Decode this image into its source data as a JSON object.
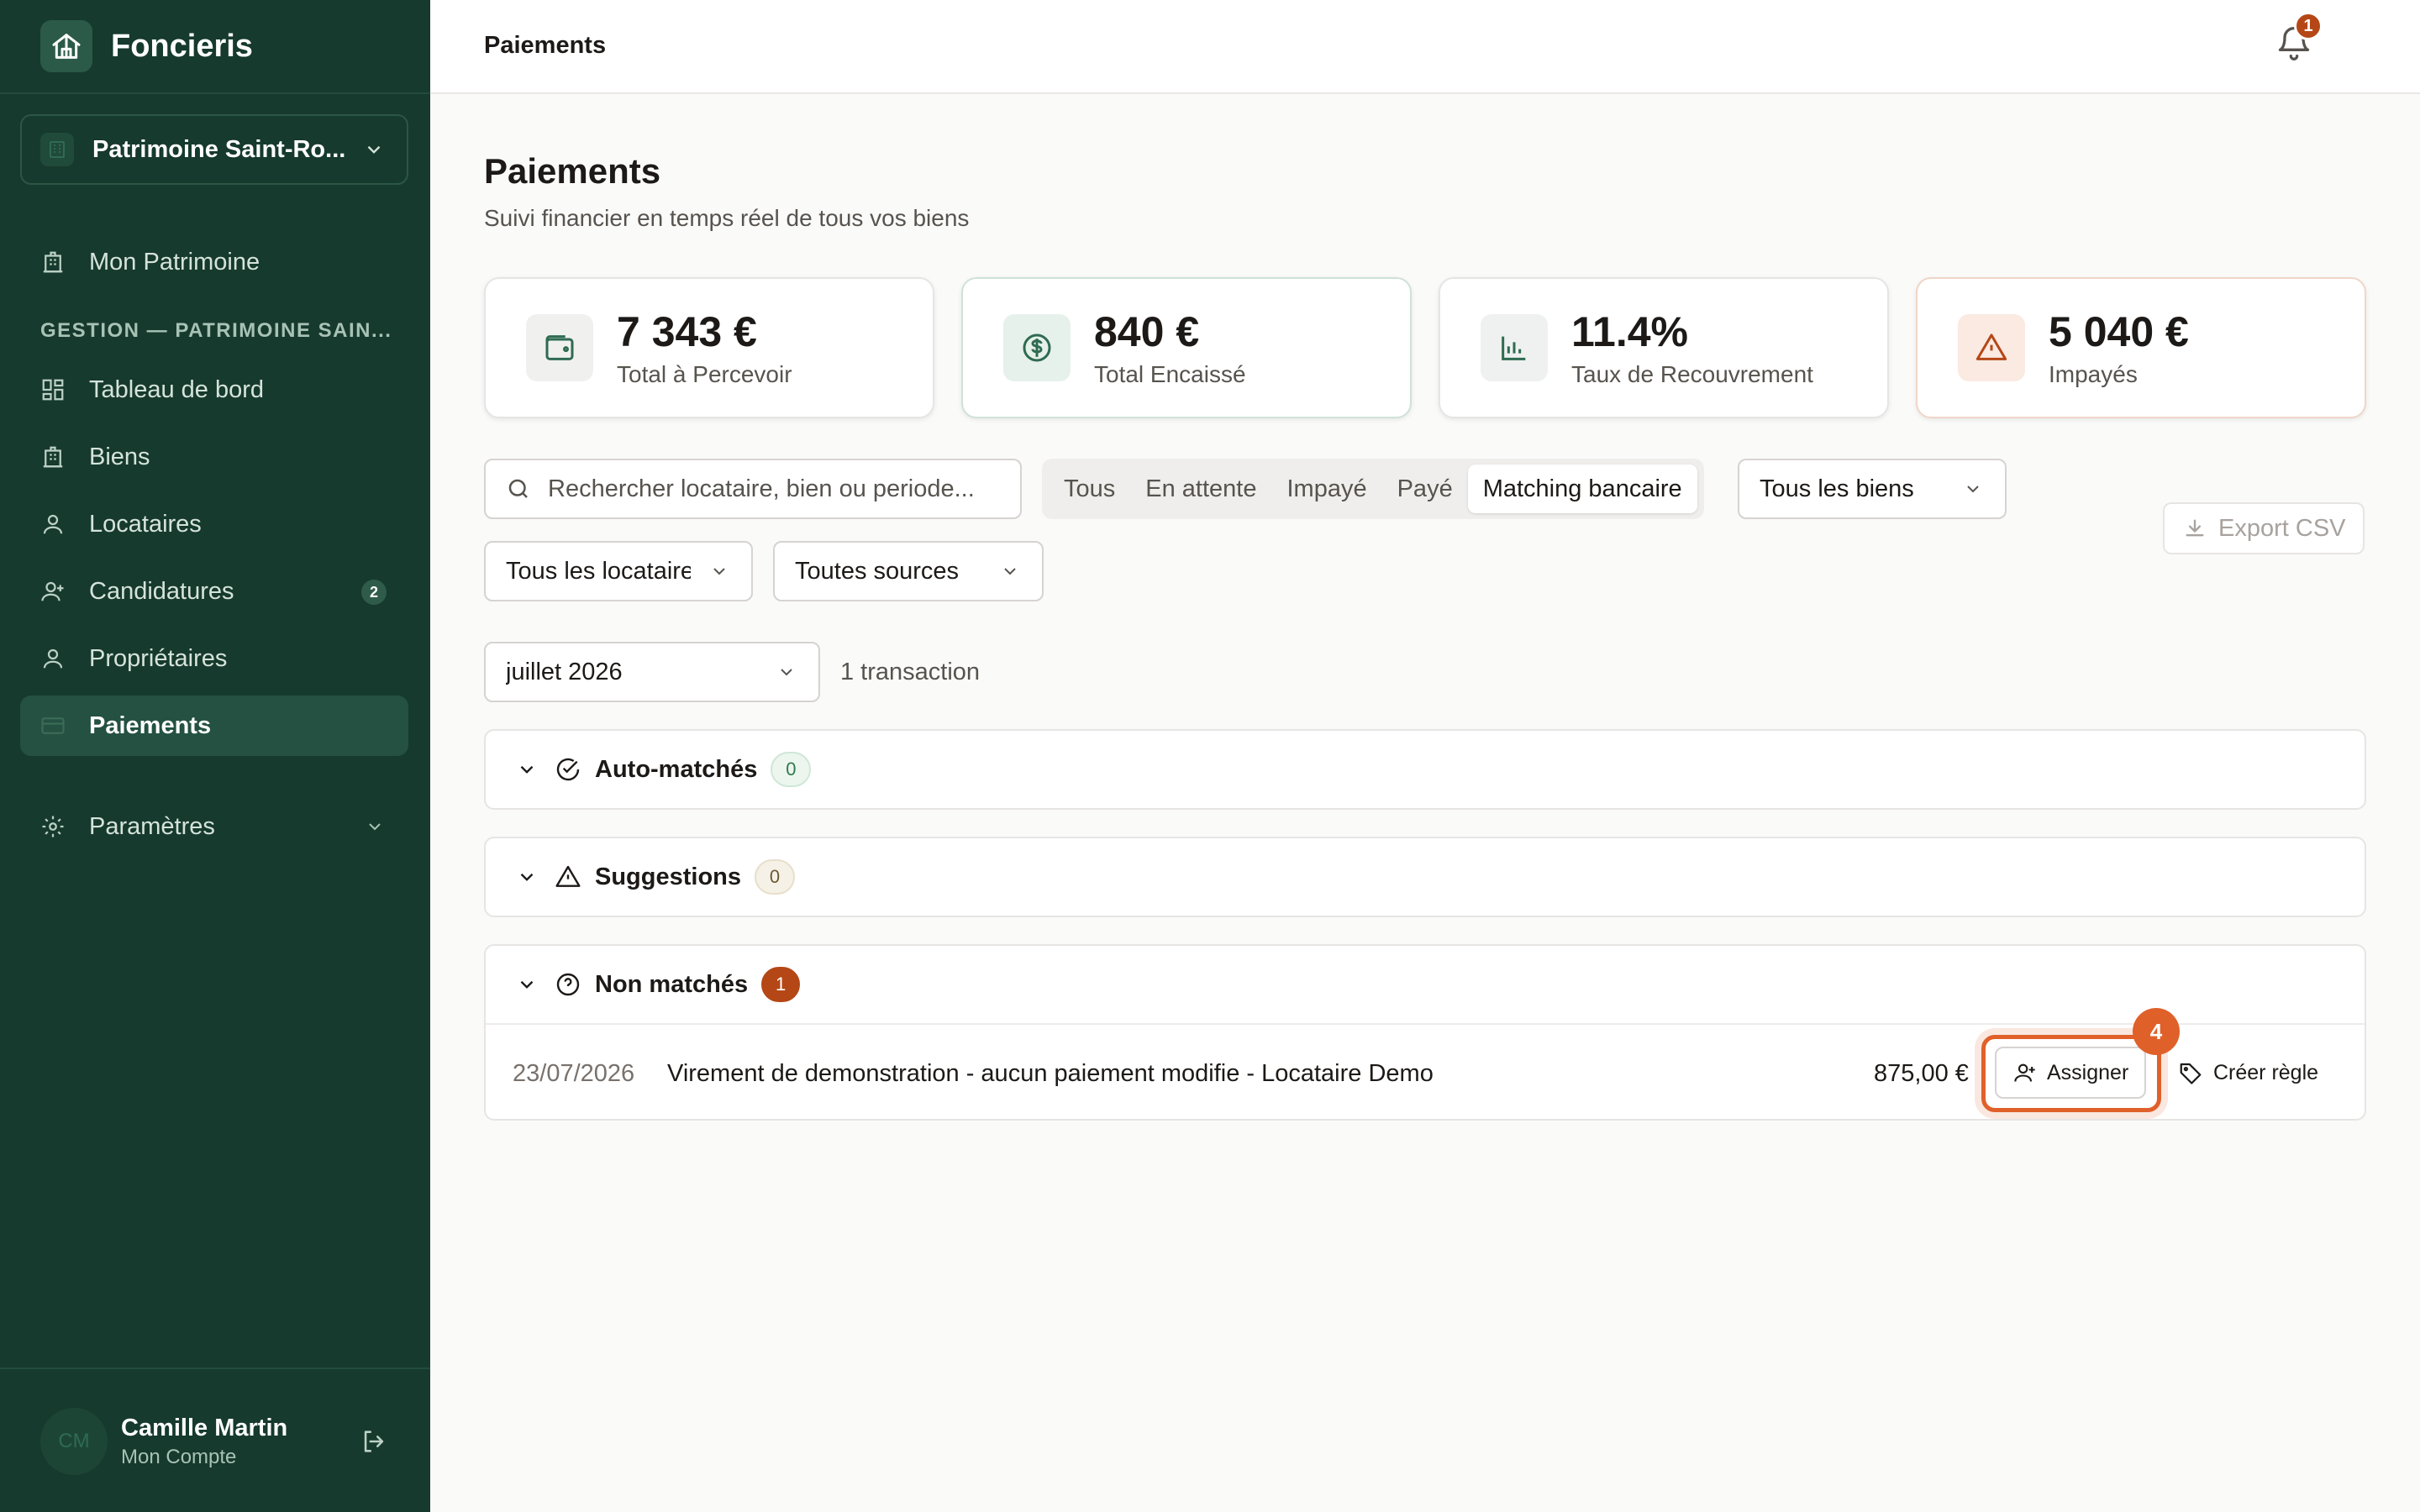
{
  "app": {
    "name": "Foncieris"
  },
  "workspace": {
    "name": "Patrimoine Saint-Ro..."
  },
  "sidebar": {
    "top_item": "Mon Patrimoine",
    "section": "GESTION — PATRIMOINE SAIN...",
    "items": [
      {
        "label": "Tableau de bord",
        "icon": "dashboard-icon"
      },
      {
        "label": "Biens",
        "icon": "building-icon"
      },
      {
        "label": "Locataires",
        "icon": "user-icon"
      },
      {
        "label": "Candidatures",
        "icon": "user-plus-icon",
        "badge": "2"
      },
      {
        "label": "Propriétaires",
        "icon": "user-icon"
      },
      {
        "label": "Paiements",
        "icon": "card-icon",
        "active": true
      }
    ],
    "settings": "Paramètres"
  },
  "user": {
    "initials": "CM",
    "name": "Camille Martin",
    "subtitle": "Mon Compte"
  },
  "topbar": {
    "title": "Paiements",
    "notifications": "1"
  },
  "page": {
    "title": "Paiements",
    "subtitle": "Suivi financier en temps réel de tous vos biens"
  },
  "kpis": [
    {
      "value": "7 343 €",
      "label": "Total à Percevoir",
      "icon": "wallet-icon"
    },
    {
      "value": "840 €",
      "label": "Total Encaissé",
      "icon": "dollar-icon"
    },
    {
      "value": "11.4%",
      "label": "Taux de Recouvrement",
      "icon": "bar-chart-icon"
    },
    {
      "value": "5 040 €",
      "label": "Impayés",
      "icon": "warning-icon"
    }
  ],
  "filters": {
    "search_placeholder": "Rechercher locataire, bien ou periode...",
    "tabs": [
      "Tous",
      "En attente",
      "Impayé",
      "Payé",
      "Matching bancaire"
    ],
    "active_tab": "Matching bancaire",
    "biens": "Tous les biens",
    "locataires": "Tous les locataires",
    "sources": "Toutes sources",
    "export": "Export CSV",
    "month": "juillet 2026",
    "count": "1 transaction"
  },
  "groups": {
    "auto": {
      "title": "Auto-matchés",
      "count": "0"
    },
    "suggestions": {
      "title": "Suggestions",
      "count": "0"
    },
    "non_matched": {
      "title": "Non matchés",
      "count": "1"
    }
  },
  "transaction": {
    "date": "23/07/2026",
    "description": "Virement de demonstration - aucun paiement modifie - Locataire Demo",
    "amount": "875,00 €",
    "assign_label": "Assigner",
    "rule_label": "Créer règle",
    "step": "4"
  },
  "colors": {
    "sidebar": "#163a2d",
    "accent": "#e0602a",
    "danger": "#b54717"
  }
}
